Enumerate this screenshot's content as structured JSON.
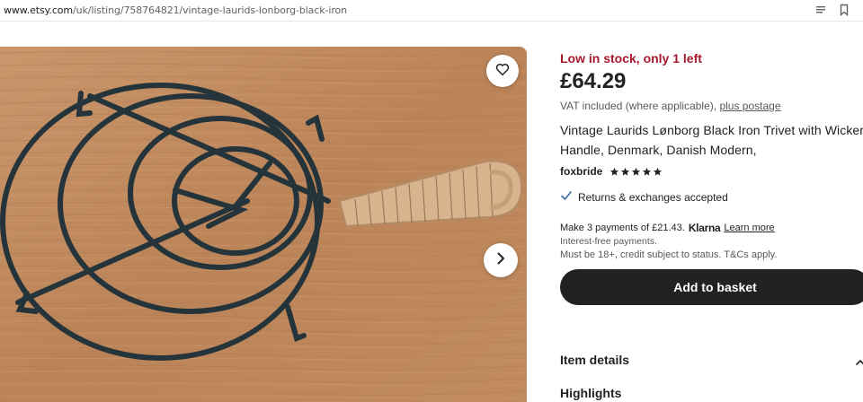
{
  "browser": {
    "url_host": "www.etsy.com",
    "url_path": "/uk/listing/758764821/vintage-laurids-lonborg-black-iron",
    "reader_icon": "reader-mode-icon",
    "bookmark_icon": "bookmark-icon"
  },
  "gallery": {
    "favorite_icon": "heart-icon",
    "next_icon": "chevron-right-icon"
  },
  "listing": {
    "stock": "Low in stock, only 1 left",
    "price": "£64.29",
    "vat_text": "VAT included (where applicable),",
    "postage_link": "plus postage",
    "title": "Vintage Laurids Lønborg Black Iron Trivet with Wicker Handle, Denmark, Danish Modern,",
    "shop_name": "foxbride",
    "rating_stars": 5,
    "returns": "Returns & exchanges accepted",
    "klarna_text": "Make 3 payments of £21.43.",
    "klarna_brand": "Klarna",
    "klarna_link": "Learn more",
    "interest_note": "Interest-free payments.",
    "credit_note": "Must be 18+, credit subject to status. T&Cs apply.",
    "add_to_basket": "Add to basket",
    "item_details": "Item details",
    "highlights": "Highlights"
  },
  "colors": {
    "stock_red": "#a61a2e",
    "button_dark": "#222222",
    "text_main": "#222222",
    "text_muted": "#595959"
  }
}
